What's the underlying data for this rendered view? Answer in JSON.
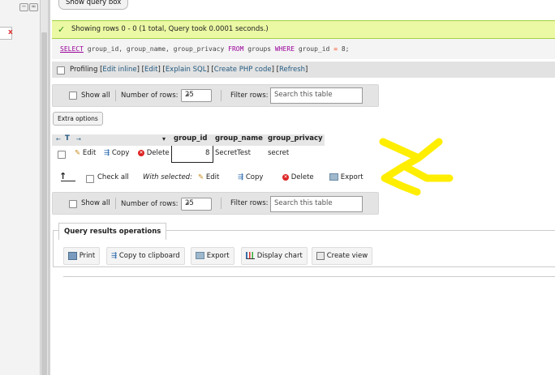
{
  "nav": {
    "close_mark": "x",
    "collapse_glyph": "−",
    "link_glyph": "∞"
  },
  "query_box_button": "Show query box",
  "success": {
    "icon": "check-icon",
    "check_glyph": "✓",
    "message": "Showing rows 0 - 0 (1 total, Query took 0.0001 seconds.)"
  },
  "sql": {
    "select": "SELECT",
    "columns": " group_id, group_name, group_privacy ",
    "from": "FROM",
    "table": " groups ",
    "where": "WHERE",
    "cond_col": " group_id ",
    "eq": "=",
    "cond_val": " 8;"
  },
  "profiling": {
    "label": "Profiling",
    "open1": "[",
    "edit_inline": "Edit inline",
    "mid1": "] [",
    "edit": "Edit",
    "mid2": "] [",
    "explain": "Explain SQL",
    "mid3": "] [",
    "php": "Create PHP code",
    "mid4": "] [",
    "refresh": "Refresh",
    "close": "]"
  },
  "navbar": {
    "show_all": "Show all",
    "rows_label": "Number of rows:",
    "rows_value": "25",
    "caret": "⌄",
    "filter_label": "Filter rows:",
    "filter_placeholder": "Search this table"
  },
  "extra_options": "Extra options",
  "table": {
    "sort_left": "←",
    "sort_mark": "T",
    "sort_right": "→",
    "sort_caret": "▾",
    "columns": [
      "group_id",
      "group_name",
      "group_privacy"
    ],
    "rows": [
      {
        "actions": {
          "edit": "Edit",
          "copy": "Copy",
          "delete": "Delete"
        },
        "group_id": "8",
        "group_name": "SecretTest",
        "group_privacy": "secret"
      }
    ]
  },
  "bulk": {
    "arrow": "↑",
    "check_all": "Check all",
    "with_selected": "With selected:",
    "edit": "Edit",
    "copy": "Copy",
    "delete": "Delete",
    "export": "Export"
  },
  "icons": {
    "edit_glyph": "✎",
    "copy_glyph": "⇶",
    "delete_glyph": "✕"
  },
  "results_ops": {
    "title": "Query results operations",
    "print": "Print",
    "copy_clipboard": "Copy to clipboard",
    "export": "Export",
    "display_chart": "Display chart",
    "create_view": "Create view"
  },
  "colors": {
    "success_bg": "#ebf8a4",
    "link": "#235a81",
    "annotation": "#ffee00",
    "sql_keyword": "#990099"
  }
}
